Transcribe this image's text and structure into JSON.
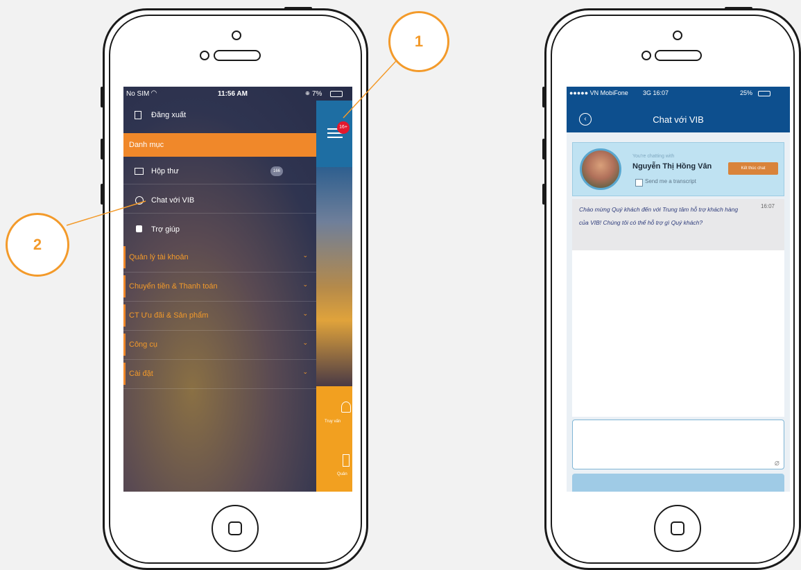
{
  "left_phone": {
    "status": {
      "carrier": "No SIM",
      "time": "11:56 AM",
      "battery": "7%"
    },
    "notification_count": "16+",
    "menu": {
      "logout": "Đăng xuất",
      "section_header": "Danh mục",
      "items": [
        {
          "label": "Hộp thư",
          "icon": "mail-icon",
          "badge": "166"
        },
        {
          "label": "Chat với VIB",
          "icon": "chat-icon"
        },
        {
          "label": "Trợ giúp",
          "icon": "help-icon"
        }
      ],
      "categories": [
        "Quản lý tài khoản",
        "Chuyển tiền & Thanh toán",
        "CT Ưu đãi & Sản phẩm",
        "Công cụ",
        "Cài đặt"
      ]
    },
    "side_panel_labels": [
      "Truy vấn",
      "Quản"
    ]
  },
  "callouts": {
    "one": "1",
    "two": "2"
  },
  "right_phone": {
    "status": {
      "carrier": "●●●●● VN MobiFone",
      "network_time": "3G 16:07",
      "battery": "25%"
    },
    "title": "Chat với VIB",
    "chatting_with_label": "You're chatting with",
    "agent_name": "Nguyễn Thị Hồng Vân",
    "end_chat_label": "Kết thúc chat",
    "transcript_label": "Send me a transcript",
    "message": {
      "text": "Chào mừng Quý khách đến với Trung tâm hỗ trợ khách hàng của VIB! Chúng tôi có thể hỗ trợ gì Quý khách?",
      "time": "16:07"
    }
  },
  "colors": {
    "accent_orange": "#f0882a",
    "vib_blue": "#0d4f8e",
    "badge_red": "#e3182d"
  }
}
